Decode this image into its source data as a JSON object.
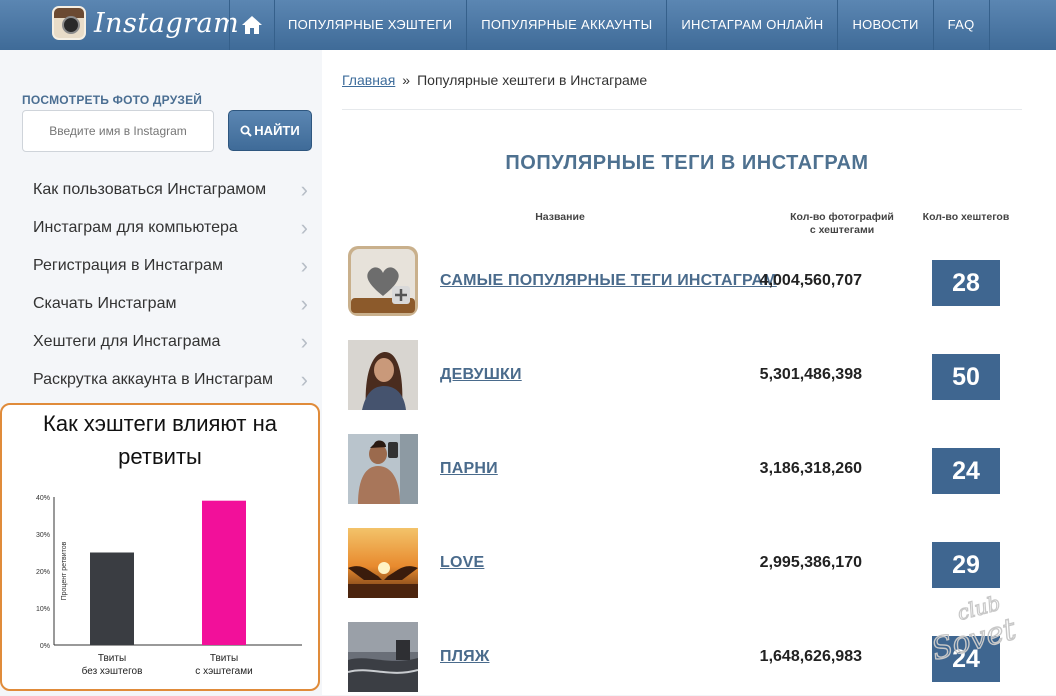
{
  "header": {
    "logo_text": "Instagram",
    "nav": [
      "ПОПУЛЯРНЫЕ ХЭШТЕГИ",
      "ПОПУЛЯРНЫЕ АККАУНТЫ",
      "ИНСТАГРАМ ОНЛАЙН",
      "НОВОСТИ",
      "FAQ"
    ]
  },
  "sidebar": {
    "friends_label": "ПОСМОТРЕТЬ ФОТО ДРУЗЕЙ",
    "search_placeholder": "Введите имя в Instagram",
    "search_button": "НАЙТИ",
    "menu": [
      "Как пользоваться Инстаграмом",
      "Инстаграм для компьютера",
      "Регистрация в Инстаграм",
      "Скачать Инстаграм",
      "Хештеги для Инстаграма",
      "Раскрутка аккаунта в Инстаграм"
    ]
  },
  "chart_data": {
    "type": "bar",
    "title": "Как хэштеги влияют на ретвиты",
    "ylabel": "Процент ретвитов",
    "categories": [
      "Твиты без хэштегов",
      "Твиты с хэштегами"
    ],
    "category_lines": [
      [
        "Твиты",
        "без хэштегов"
      ],
      [
        "Твиты",
        "с хэштегами"
      ]
    ],
    "values": [
      25,
      39
    ],
    "ylim": [
      0,
      40
    ],
    "yticks": [
      "0%",
      "10%",
      "20%",
      "30%",
      "40%"
    ],
    "yticks_values": [
      0,
      10,
      20,
      30,
      40
    ],
    "colors": [
      "#3a3d42",
      "#f2109a"
    ]
  },
  "main": {
    "breadcrumb": {
      "home": "Главная",
      "separator": "»",
      "current": "Популярные хештеги в Инстаграме"
    },
    "title": "ПОПУЛЯРНЫЕ ТЕГИ В ИНСТАГРАМ",
    "columns": {
      "name": "Название",
      "photos_line1": "Кол-во фотографий",
      "photos_line2": "с хештегами",
      "count": "Кол-во хештегов"
    },
    "rows": [
      {
        "tag": "САМЫЕ ПОПУЛЯРНЫЕ ТЕГИ ИНСТАГРАМ",
        "photos": "4,004,560,707",
        "count": "28"
      },
      {
        "tag": "ДЕВУШКИ",
        "photos": "5,301,486,398",
        "count": "50"
      },
      {
        "tag": "ПАРНИ",
        "photos": "3,186,318,260",
        "count": "24"
      },
      {
        "tag": "LOVE",
        "photos": "2,995,386,170",
        "count": "29"
      },
      {
        "tag": "ПЛЯЖ",
        "photos": "1,648,626,983",
        "count": "24"
      }
    ]
  },
  "watermark": {
    "line1": "club",
    "line2": "Sovet"
  }
}
